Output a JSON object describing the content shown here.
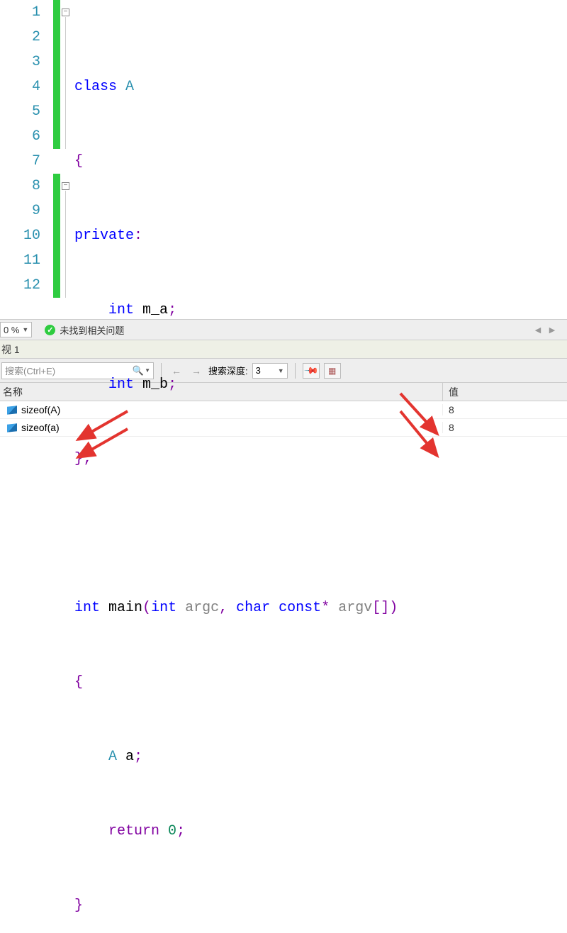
{
  "code": {
    "lines": [
      "1",
      "2",
      "3",
      "4",
      "5",
      "6",
      "7",
      "8",
      "9",
      "10",
      "11",
      "12"
    ]
  },
  "tokens": {
    "class": "class",
    "A": "A",
    "lbr": "{",
    "private": "private",
    "colon": ":",
    "int": "int",
    "m_a": "m_a",
    "m_b": "m_b",
    "semi": ";",
    "rbr": "}",
    "main": "main",
    "lparen": "(",
    "rparen": ")",
    "argc": "argc",
    "comma": ",",
    "char": "char",
    "const": "const",
    "star": "*",
    "argv": "argv",
    "lbracket": "[",
    "rbracket": "]",
    "a_var": "a",
    "return": "return",
    "zero": "0"
  },
  "zoom": {
    "value": "0 %"
  },
  "status": {
    "ok_label": "未找到相关问题"
  },
  "panel": {
    "title": "视 1"
  },
  "search": {
    "placeholder": "搜索(Ctrl+E)",
    "depth_label": "搜索深度:",
    "depth_value": "3"
  },
  "watch": {
    "header_name": "名称",
    "header_value": "值",
    "rows": [
      {
        "name": "sizeof(A)",
        "value": "8"
      },
      {
        "name": "sizeof(a)",
        "value": "8"
      }
    ]
  }
}
